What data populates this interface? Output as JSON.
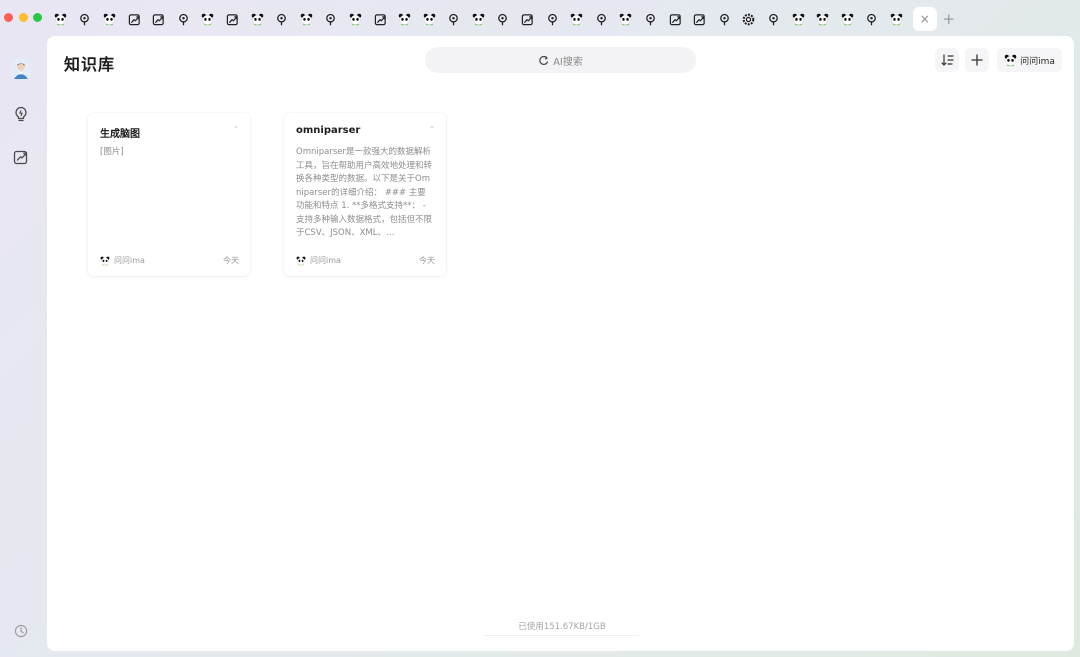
{
  "window": {
    "traffic_lights": {
      "close": "#fe5f57",
      "minimize": "#febc2e",
      "zoom": "#28c840"
    }
  },
  "tabbar": {
    "tab_icons": [
      "panda-icon",
      "lightbulb-icon",
      "panda-icon",
      "edit-square-icon",
      "edit-square-icon",
      "lightbulb-icon",
      "panda-icon",
      "edit-square-icon",
      "panda-icon",
      "lightbulb-icon",
      "panda-icon",
      "lightbulb-icon",
      "panda-icon",
      "edit-square-icon",
      "panda-icon",
      "panda-icon",
      "lightbulb-icon",
      "panda-icon",
      "lightbulb-icon",
      "edit-square-icon",
      "lightbulb-icon",
      "panda-icon",
      "lightbulb-icon",
      "panda-icon",
      "lightbulb-icon",
      "edit-square-icon",
      "edit-square-icon",
      "lightbulb-icon",
      "settings-icon",
      "lightbulb-icon",
      "panda-icon",
      "panda-icon",
      "panda-icon",
      "lightbulb-icon",
      "panda-icon"
    ],
    "active_tab_close": "×",
    "new_tab": "+"
  },
  "sidebar": {
    "items": [
      {
        "icon": "user-avatar"
      },
      {
        "icon": "lightbulb-icon"
      },
      {
        "icon": "edit-square-icon"
      }
    ],
    "bottom_icon": "history-icon"
  },
  "header": {
    "title": "知识库",
    "search_placeholder": "AI搜索",
    "ask_label": "问问ima"
  },
  "cards": [
    {
      "title": "生成脑图",
      "more": "··",
      "snippet": "[图片]",
      "source": "问问ima",
      "date": "今天"
    },
    {
      "title": "omniparser",
      "more": "··",
      "snippet": "Omniparser是一款强大的数据解析工具，旨在帮助用户高效地处理和转换各种类型的数据。以下是关于Omniparser的详细介绍： ### 主要功能和特点 1. **多格式支持**： - 支持多种输入数据格式，包括但不限于CSV、JSON、XML、…",
      "source": "问问ima",
      "date": "今天"
    }
  ],
  "footer": {
    "storage": "已使用151.67KB/1GB"
  },
  "colors": {
    "panel_bg": "#ffffff",
    "search_bg": "#f3f3f5",
    "title_text": "#1d1d1d",
    "muted_text": "#8d8d8d"
  }
}
